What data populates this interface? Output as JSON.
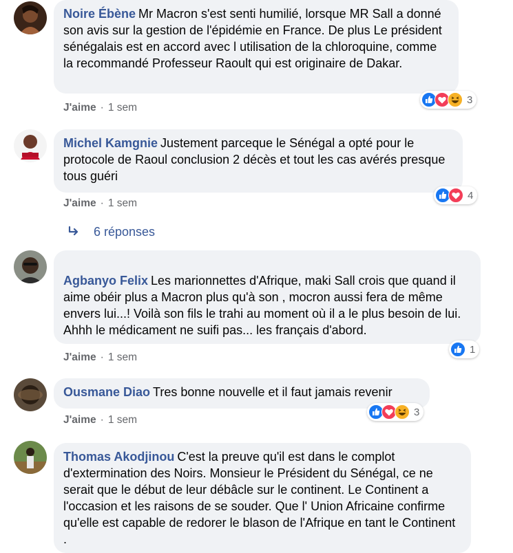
{
  "comments": [
    {
      "author": "Noire Ébène",
      "text": "Mr Macron s'est senti humilié, lorsque MR Sall a donné son avis sur la gestion de l'épidémie en France. De plus Le président sénégalais est en accord avec l utilisation de la chloroquine, comme la recommandé Professeur Raoult qui est originaire de Dakar.",
      "like_label": "J'aime",
      "time": "1 sem",
      "reactions": [
        "like-icon",
        "love-icon",
        "haha-icon"
      ],
      "reaction_count": "3"
    },
    {
      "author": "Michel Kamgnie",
      "text": "Justement parceque le Sénégal a opté pour le protocole de Raoul conclusion 2 décès et tout les cas avérés presque tous guéri",
      "like_label": "J'aime",
      "time": "1 sem",
      "reactions": [
        "like-icon",
        "love-icon"
      ],
      "reaction_count": "4",
      "replies_label": "6 réponses"
    },
    {
      "author": "Agbanyo Felix",
      "text": "Les marionnettes d'Afrique, maki Sall crois que quand il aime obéir plus a Macron plus qu'à son , mocron aussi fera de même envers lui...! Voilà son fils le trahi au moment où il a le plus besoin de lui.\nAhhh le médicament ne suifi pas... les français d'abord.",
      "like_label": "J'aime",
      "time": "1 sem",
      "reactions": [
        "like-icon"
      ],
      "reaction_count": "1"
    },
    {
      "author": "Ousmane Diao",
      "text": "Tres bonne nouvelle et il faut jamais revenir",
      "like_label": "J'aime",
      "time": "1 sem",
      "reactions": [
        "like-icon",
        "love-icon",
        "haha-icon"
      ],
      "reaction_count": "3"
    },
    {
      "author": "Thomas Akodjinou",
      "text": "C'est la preuve qu'il est dans le complot d'extermination des Noirs. Monsieur le Président du Sénégal, ce ne serait que le début de leur débâcle sur le continent. Le Continent a l'occasion et les raisons de se souder. Que l' Union Africaine confirme qu'elle est capable de redorer le blason de l'Afrique en tant le Continent ."
    }
  ],
  "colors": {
    "author": "#385898",
    "bubble": "#f0f2f5",
    "meta": "#65676b",
    "like_blue": "#1877f2",
    "love_red": "#f33e58",
    "haha_yellow": "#f7b125"
  }
}
